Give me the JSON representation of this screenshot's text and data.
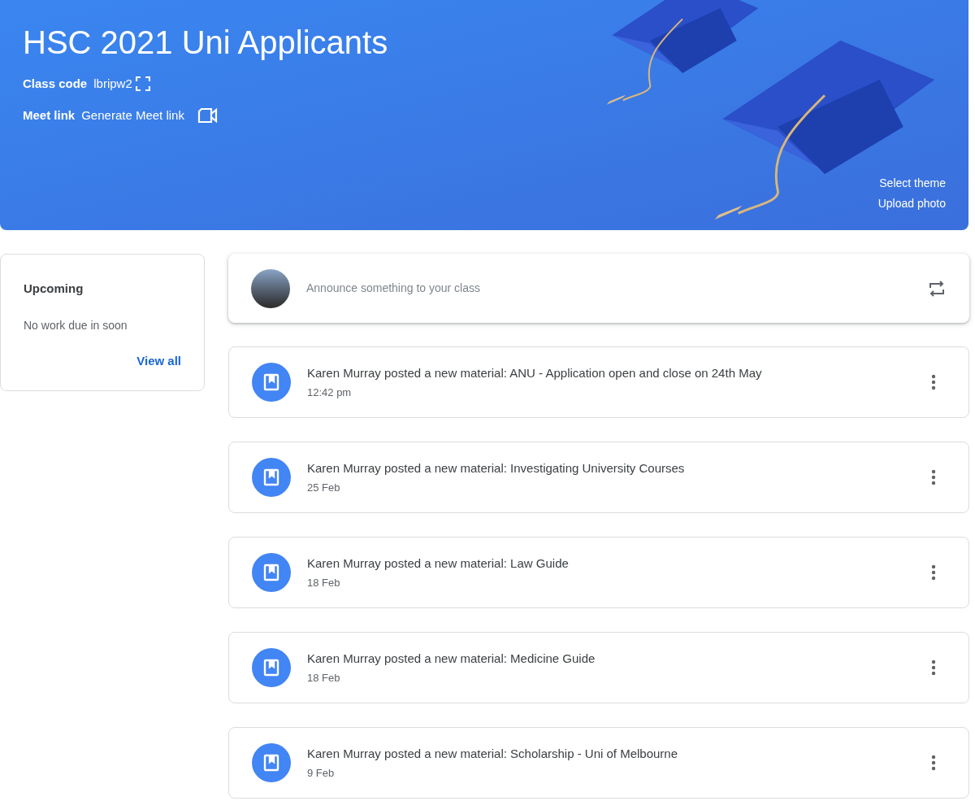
{
  "banner": {
    "title": "HSC 2021 Uni Applicants",
    "class_code_label": "Class code",
    "class_code": "lbripw2",
    "meet_label": "Meet link",
    "meet_link": "Generate Meet link",
    "actions": [
      "Select theme",
      "Upload photo"
    ]
  },
  "upcoming": {
    "title": "Upcoming",
    "message": "No work due in soon",
    "link": "View all"
  },
  "composer": {
    "placeholder": "Announce something to your class"
  },
  "posts": [
    {
      "text": "Karen Murray posted a new material: ANU - Application open and close on 24th May",
      "time": "12:42 pm"
    },
    {
      "text": "Karen Murray posted a new material: Investigating University Courses",
      "time": "25 Feb"
    },
    {
      "text": "Karen Murray posted a new material: Law Guide",
      "time": "18 Feb"
    },
    {
      "text": "Karen Murray posted a new material: Medicine Guide",
      "time": "18 Feb"
    },
    {
      "text": "Karen Murray posted a new material: Scholarship - Uni of Melbourne",
      "time": "9 Feb"
    }
  ]
}
